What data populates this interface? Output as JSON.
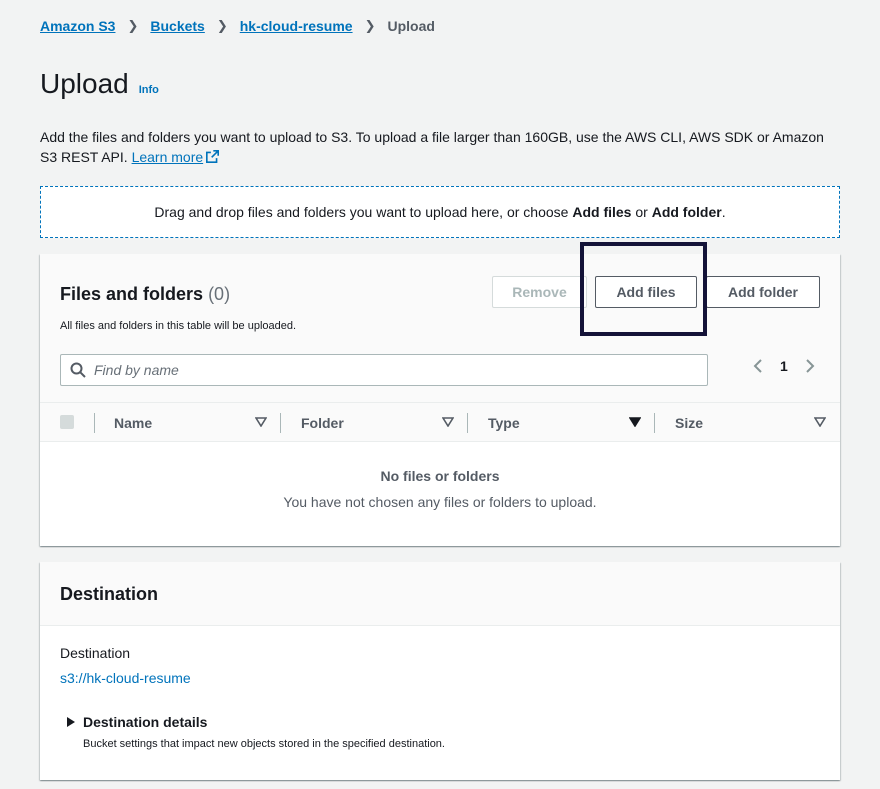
{
  "breadcrumb": {
    "items": [
      "Amazon S3",
      "Buckets",
      "hk-cloud-resume"
    ],
    "current": "Upload"
  },
  "header": {
    "title": "Upload",
    "info": "Info"
  },
  "description": {
    "text": "Add the files and folders you want to upload to S3. To upload a file larger than 160GB, use the AWS CLI, AWS SDK or Amazon S3 REST API. ",
    "learn_more": "Learn more"
  },
  "dropzone": {
    "prefix": "Drag and drop files and folders you want to upload here, or choose ",
    "add_files": "Add files",
    "or": " or ",
    "add_folder": "Add folder",
    "suffix": "."
  },
  "files_panel": {
    "title": "Files and folders",
    "count": "(0)",
    "subtitle": "All files and folders in this table will be uploaded.",
    "remove_label": "Remove",
    "add_files_label": "Add files",
    "add_folder_label": "Add folder",
    "search_placeholder": "Find by name",
    "page": "1",
    "columns": [
      "Name",
      "Folder",
      "Type",
      "Size"
    ],
    "empty_title": "No files or folders",
    "empty_sub": "You have not chosen any files or folders to upload."
  },
  "destination": {
    "title": "Destination",
    "label": "Destination",
    "value": "s3://hk-cloud-resume",
    "details_label": "Destination details",
    "details_sub": "Bucket settings that impact new objects stored in the specified destination."
  },
  "colors": {
    "link": "#0073bb",
    "highlight": "#141338",
    "background": "#f2f3f3"
  }
}
